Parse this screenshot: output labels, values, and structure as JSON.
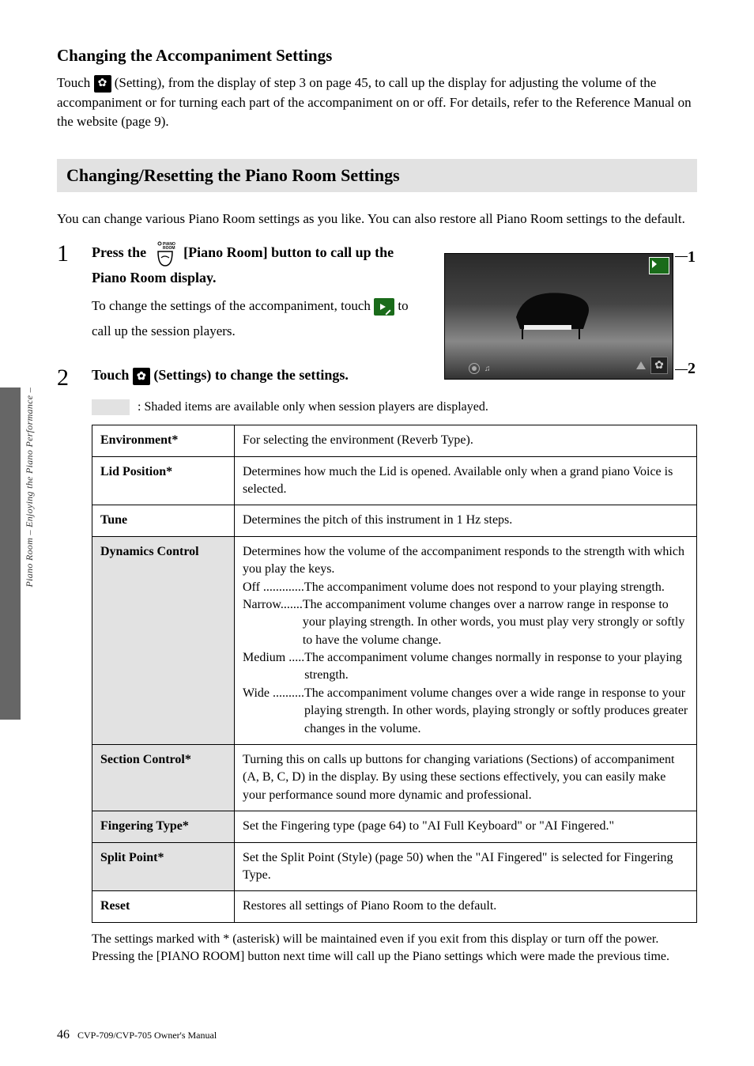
{
  "headings": {
    "h3_changing_accomp": "Changing the Accompaniment Settings",
    "section_bar": "Changing/Resetting the Piano Room Settings"
  },
  "para": {
    "accomp_1a": "Touch ",
    "accomp_1b": " (Setting), from the display of step 3 on page 45, to call up the display for adjusting the volume of the accompaniment or for turning each part of the accompaniment on or off. For details, refer to the Reference Manual on the website (page 9).",
    "sect_intro": "You can change various Piano Room settings as you like. You can also restore all Piano Room settings to the default."
  },
  "steps": {
    "s1_num": "1",
    "s1_a": "Press the ",
    "s1_b": " [Piano Room] button to call up the Piano Room display.",
    "s1_sub_a": "To change the settings of the accompaniment, touch ",
    "s1_sub_b": " to call up the session players.",
    "s2_num": "2",
    "s2_a": "Touch ",
    "s2_b": " (Settings) to change the settings."
  },
  "legend": " : Shaded items are available only when session players are displayed.",
  "figure": {
    "label1": "1",
    "label2": "2"
  },
  "table": {
    "environment": {
      "label": "Environment*",
      "desc": "For selecting the environment (Reverb Type)."
    },
    "lid": {
      "label": "Lid Position*",
      "desc": "Determines how much the Lid is opened. Available only when a grand piano Voice is selected."
    },
    "tune": {
      "label": "Tune",
      "desc": "Determines the pitch of this instrument in 1 Hz steps."
    },
    "dyn": {
      "label": "Dynamics Control",
      "intro": "Determines how the volume of the accompaniment responds to the strength with which you play the keys.",
      "off_t": "Off .............",
      "off_d": "The accompaniment volume does not respond to your playing strength.",
      "narrow_t": "Narrow.......",
      "narrow_d": "The accompaniment volume changes over a narrow range in response to your playing strength. In other words, you must play very strongly or softly to have the volume change.",
      "medium_t": "Medium .....",
      "medium_d": "The accompaniment volume changes normally in response to your playing strength.",
      "wide_t": "Wide ..........",
      "wide_d": "The accompaniment volume changes over a wide range in response to your playing strength. In other words, playing strongly or softly produces greater changes in the volume."
    },
    "section": {
      "label": "Section Control*",
      "desc": "Turning this on calls up buttons for changing variations (Sections) of accompaniment (A, B, C, D) in the display. By using these sections effectively, you can easily make your performance sound more dynamic and professional."
    },
    "fingering": {
      "label": "Fingering Type*",
      "desc": "Set the Fingering type (page 64) to \"AI Full Keyboard\" or \"AI Fingered.\""
    },
    "split": {
      "label": "Split Point*",
      "desc": "Set the Split Point (Style) (page 50) when the \"AI Fingered\" is selected for Fingering Type."
    },
    "reset": {
      "label": "Reset",
      "desc": "Restores all settings of Piano Room to the default."
    }
  },
  "table_note": "The settings marked with * (asterisk) will be maintained even if you exit from this display or turn off the power. Pressing the [PIANO ROOM] button next time will call up the Piano settings which were made the previous time.",
  "side_tab": "Piano Room – Enjoying the Piano Performance –",
  "footer": {
    "page": "46",
    "manual": "CVP-709/CVP-705 Owner's Manual"
  },
  "icons": {
    "gear": "gear-icon",
    "green_play": "session-players-icon",
    "piano_room_btn": "piano-room-button-icon"
  }
}
